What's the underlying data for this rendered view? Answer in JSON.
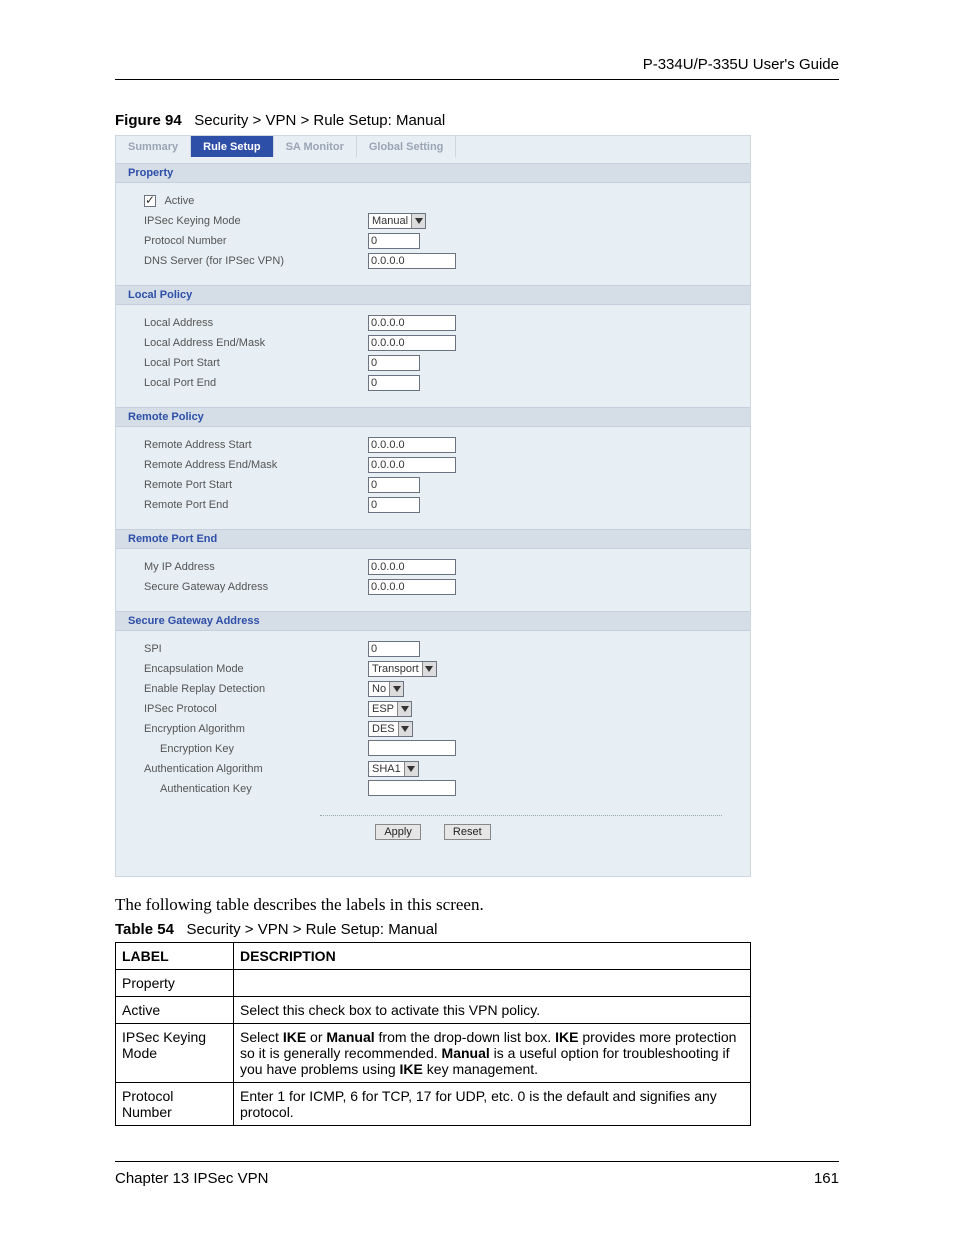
{
  "header": {
    "guide_title": "P-334U/P-335U User's Guide"
  },
  "figure": {
    "label": "Figure 94",
    "caption": "Security > VPN > Rule Setup: Manual"
  },
  "tabs": {
    "items": [
      {
        "label": "Summary"
      },
      {
        "label": "Rule Setup"
      },
      {
        "label": "SA Monitor"
      },
      {
        "label": "Global Setting"
      }
    ],
    "active_index": 1
  },
  "sections": {
    "property": {
      "title": "Property",
      "active_label": "Active",
      "rows": [
        {
          "label": "IPSec Keying Mode",
          "type": "select",
          "value": "Manual"
        },
        {
          "label": "Protocol Number",
          "type": "text",
          "value": "0",
          "w": "w54"
        },
        {
          "label": "DNS Server (for IPSec VPN)",
          "type": "text",
          "value": "0.0.0.0",
          "w": "w90"
        }
      ]
    },
    "local": {
      "title": "Local Policy",
      "rows": [
        {
          "label": "Local Address",
          "type": "text",
          "value": "0.0.0.0",
          "w": "w90"
        },
        {
          "label": "Local Address End/Mask",
          "type": "text",
          "value": "0.0.0.0",
          "w": "w90"
        },
        {
          "label": "Local Port Start",
          "type": "text",
          "value": "0",
          "w": "w54"
        },
        {
          "label": "Local Port End",
          "type": "text",
          "value": "0",
          "w": "w54"
        }
      ]
    },
    "remote": {
      "title": "Remote Policy",
      "rows": [
        {
          "label": "Remote Address Start",
          "type": "text",
          "value": "0.0.0.0",
          "w": "w90"
        },
        {
          "label": "Remote Address End/Mask",
          "type": "text",
          "value": "0.0.0.0",
          "w": "w90"
        },
        {
          "label": "Remote Port Start",
          "type": "text",
          "value": "0",
          "w": "w54"
        },
        {
          "label": "Remote Port End",
          "type": "text",
          "value": "0",
          "w": "w54"
        }
      ]
    },
    "rpe": {
      "title": "Remote Port End",
      "rows": [
        {
          "label": "My IP Address",
          "type": "text",
          "value": "0.0.0.0",
          "w": "w90"
        },
        {
          "label": "Secure Gateway Address",
          "type": "text",
          "value": "0.0.0.0",
          "w": "w90"
        }
      ]
    },
    "sga": {
      "title": "Secure Gateway Address",
      "rows": [
        {
          "label": "SPI",
          "type": "text",
          "value": "0",
          "w": "w54"
        },
        {
          "label": "Encapsulation Mode",
          "type": "select",
          "value": "Transport"
        },
        {
          "label": "Enable Replay Detection",
          "type": "select",
          "value": "No"
        },
        {
          "label": "IPSec Protocol",
          "type": "select",
          "value": "ESP"
        },
        {
          "label": "Encryption Algorithm",
          "type": "select",
          "value": "DES"
        },
        {
          "label": "Encryption Key",
          "type": "text",
          "value": "",
          "w": "w90",
          "indent": true
        },
        {
          "label": "Authentication Algorithm",
          "type": "select",
          "value": "SHA1"
        },
        {
          "label": "Authentication Key",
          "type": "text",
          "value": "",
          "w": "w90",
          "indent": true
        }
      ]
    }
  },
  "buttons": {
    "apply": "Apply",
    "reset": "Reset"
  },
  "paragraph": "The following table describes the labels in this screen.",
  "table_caption": {
    "label": "Table 54",
    "caption": "Security > VPN > Rule Setup: Manual"
  },
  "table": {
    "headers": [
      "LABEL",
      "DESCRIPTION"
    ],
    "rows": [
      {
        "label": "Property",
        "desc": ""
      },
      {
        "label": "Active",
        "desc": "Select this check box to activate this VPN policy."
      },
      {
        "label": "IPSec Keying Mode",
        "desc_html": "Select <b>IKE</b> or <b>Manual</b> from the drop-down list box. <b>IKE</b> provides more protection so it is generally recommended. <b>Manual</b> is a useful option for troubleshooting if you have problems using <b>IKE</b> key management."
      },
      {
        "label": "Protocol Number",
        "desc": "Enter 1 for ICMP, 6 for TCP, 17 for UDP, etc. 0 is the default and signifies any protocol."
      }
    ]
  },
  "footer": {
    "chapter": "Chapter 13 IPSec VPN",
    "page": "161"
  }
}
